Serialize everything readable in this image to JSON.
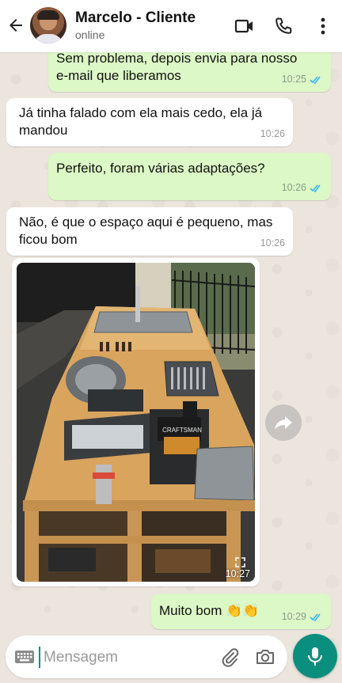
{
  "header": {
    "contact_name": "Marcelo - Cliente",
    "status": "online",
    "icons": [
      "back-arrow-icon",
      "video-call-icon",
      "phone-call-icon",
      "more-options-icon"
    ]
  },
  "messages": [
    {
      "direction": "out",
      "text": "Sem problema, depois envia para nosso\ne-mail que liberamos",
      "time": "10:25",
      "read": true
    },
    {
      "direction": "in",
      "text": "Já tinha falado com ela mais cedo, ela já\nmandou",
      "time": "10:26"
    },
    {
      "direction": "out",
      "text": "Perfeito, foram várias adaptações?",
      "time": "10:26",
      "read": true
    },
    {
      "direction": "in",
      "text": "Não, é que o espaço aqui é pequeno, mas\nficou bom",
      "time": "10:26"
    },
    {
      "direction": "in",
      "type": "image",
      "time": "10:27",
      "image_label": "CRAFTSMAN"
    },
    {
      "direction": "out",
      "text": "Muito bom 👏👏",
      "time": "10:29",
      "read": true
    }
  ],
  "composer": {
    "placeholder": "Mensagem",
    "icons": [
      "keyboard-icon",
      "attach-icon",
      "camera-icon",
      "microphone-icon"
    ]
  },
  "colors": {
    "outgoing_bubble": "#dcf8c6",
    "incoming_bubble": "#ffffff",
    "accent": "#0a8f7e",
    "read_ticks": "#34b7f1"
  }
}
